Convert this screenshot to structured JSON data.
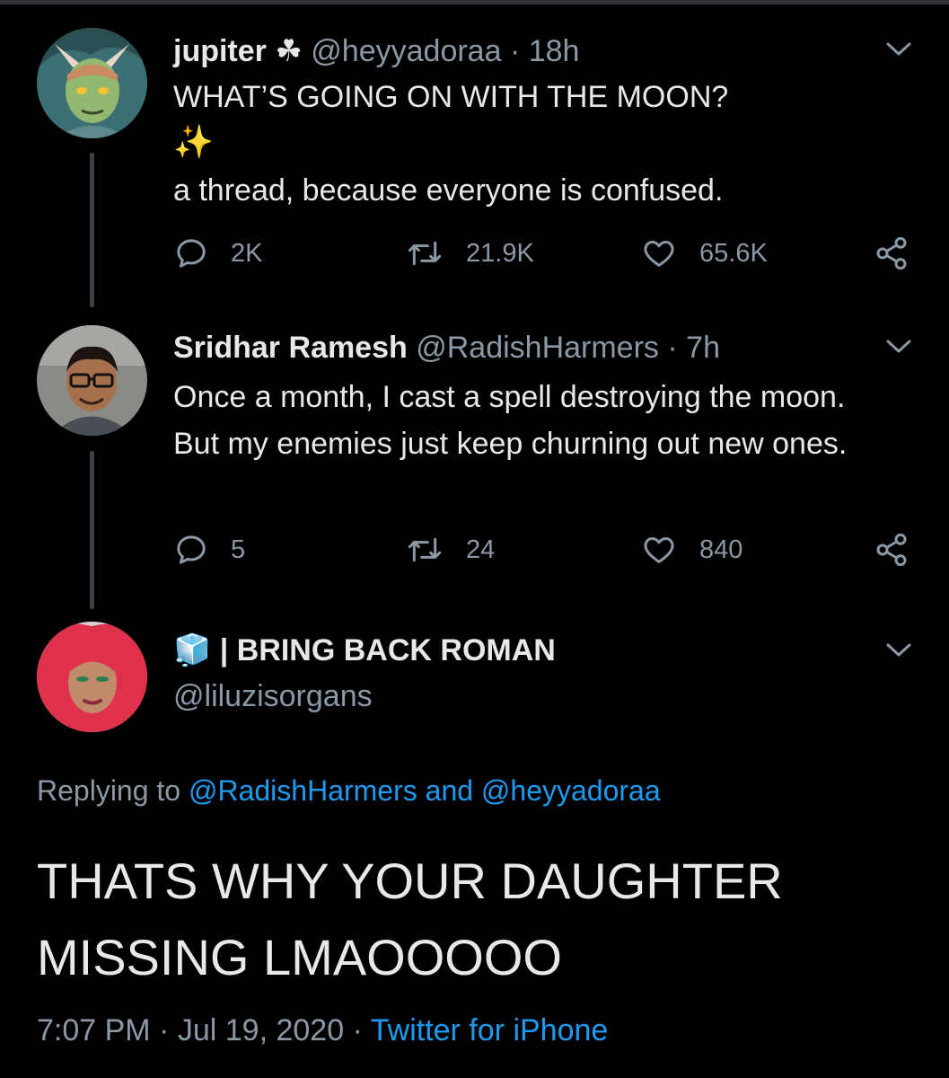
{
  "tweets": [
    {
      "name": "jupiter",
      "name_emoji": "☘",
      "handle": "@heyyadoraa",
      "time": "18h",
      "text_line1": "WHAT’S GOING ON WITH THE MOON?",
      "text_line2": "✨",
      "text_line3": "a thread, because everyone is confused.",
      "replies": "2K",
      "retweets": "21.9K",
      "likes": "65.6K"
    },
    {
      "name": "Sridhar Ramesh",
      "handle": "@RadishHarmers",
      "time": "7h",
      "text": "Once a month, I cast a spell destroying the moon. But my enemies just keep churning out new ones.",
      "replies": "5",
      "retweets": "24",
      "likes": "840"
    }
  ],
  "main_tweet": {
    "name_emoji": "🧊",
    "name": "| BRING BACK ROMAN",
    "handle": "@liluzisorgans",
    "replying_prefix": "Replying to",
    "replying_user1": "@RadishHarmers",
    "replying_and": "and",
    "replying_user2": "@heyyadoraa",
    "text_line1": "THATS WHY YOUR DAUGHTER",
    "text_line2": "MISSING LMAOOOOO",
    "time": "7:07 PM",
    "date": "Jul 19, 2020",
    "source": "Twitter for iPhone"
  },
  "separator": "·",
  "colors": {
    "background": "#000000",
    "text": "#e8e8e8",
    "muted": "#8b98a5",
    "link": "#1d9bf0",
    "thread_line": "#3d4145"
  }
}
